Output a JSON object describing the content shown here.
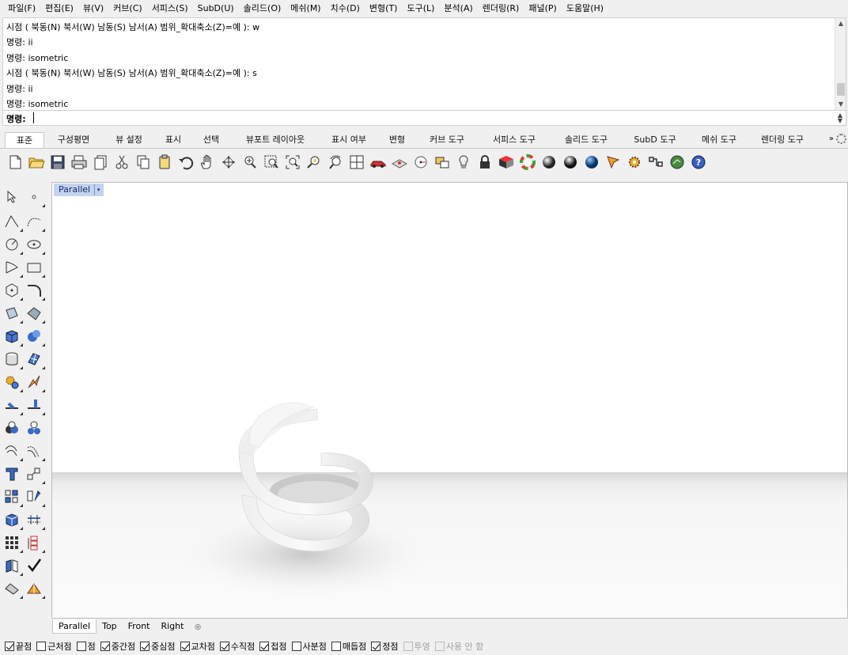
{
  "menu": [
    "파일(F)",
    "편집(E)",
    "뷰(V)",
    "커브(C)",
    "서피스(S)",
    "SubD(U)",
    "솔리드(O)",
    "메쉬(M)",
    "치수(D)",
    "변형(T)",
    "도구(L)",
    "분석(A)",
    "렌더링(R)",
    "패널(P)",
    "도움말(H)"
  ],
  "command_history": [
    "시점 ( 북동(N)  북서(W)  남동(S)  남서(A)  범위_확대축소(Z)=예 ): w",
    "명령: ii",
    "명령: isometric",
    "시점 ( 북동(N)  북서(W)  남동(S)  남서(A)  범위_확대축소(Z)=예 ): s",
    "명령: ii",
    "명령: isometric"
  ],
  "command_prompt": "명령:",
  "command_input_value": "",
  "toolbar_tabs": [
    "표준",
    "구성평면",
    "뷰 설정",
    "표시",
    "선택",
    "뷰포트 레이아웃",
    "표시 여부",
    "변형",
    "커브 도구",
    "서피스 도구",
    "솔리드 도구",
    "SubD 도구",
    "메쉬 도구",
    "렌더링 도구"
  ],
  "toolbar_tabs_more": "»",
  "main_toolbar_icons": [
    "new-icon",
    "open-icon",
    "save-icon",
    "print-icon",
    "import-icon",
    "cut-icon",
    "copy-icon",
    "paste-icon",
    "undo-icon",
    "pan-icon",
    "rotate-view-icon",
    "zoom-dynamic-icon",
    "zoom-window-icon",
    "zoom-extents-icon",
    "zoom-selected-icon",
    "undo-view-icon",
    "four-viewports-icon",
    "car-icon",
    "construction-plane-icon",
    "named-view-icon",
    "layers-icon",
    "light-icon",
    "lock-icon",
    "material-icon",
    "color-wheel-icon",
    "shaded-sphere-icon",
    "rendered-sphere-icon",
    "blue-sphere-icon",
    "render-icon",
    "options-gear-icon",
    "grasshopper-icon",
    "globe-icon",
    "help-icon"
  ],
  "left_toolbar_icons": [
    "select-arrow-icon",
    "point-icon",
    "polyline-icon",
    "curve-icon",
    "circle-icon",
    "ellipse-icon",
    "arc-icon",
    "rectangle-icon",
    "polygon-icon",
    "fillet-icon",
    "surface-icon",
    "extrude-icon",
    "box-icon",
    "sphere-icon",
    "cylinder-icon",
    "mesh-surface-icon",
    "gear-icon",
    "explode-icon",
    "split-icon",
    "trim-icon",
    "boolean-union-icon",
    "boolean-split-icon",
    "offset-icon",
    "blend-icon",
    "text-icon",
    "scale-icon",
    "array-icon",
    "mirror-icon",
    "cage-edit-icon",
    "align-icon",
    "grid-snap-icon",
    "dimension-icon",
    "transform-icon",
    "check-icon",
    "paint-icon",
    "analysis-icon"
  ],
  "viewport": {
    "label": "Parallel",
    "dropdown_glyph": "▾"
  },
  "view_tabs": [
    "Parallel",
    "Top",
    "Front",
    "Right"
  ],
  "view_tab_add": "⊕",
  "osnaps": [
    {
      "label": "끝점",
      "checked": true,
      "enabled": true
    },
    {
      "label": "근처점",
      "checked": false,
      "enabled": true
    },
    {
      "label": "점",
      "checked": false,
      "enabled": true
    },
    {
      "label": "중간점",
      "checked": true,
      "enabled": true
    },
    {
      "label": "중심점",
      "checked": true,
      "enabled": true
    },
    {
      "label": "교차점",
      "checked": true,
      "enabled": true
    },
    {
      "label": "수직점",
      "checked": true,
      "enabled": true
    },
    {
      "label": "접점",
      "checked": true,
      "enabled": true
    },
    {
      "label": "사분점",
      "checked": false,
      "enabled": true
    },
    {
      "label": "매듭점",
      "checked": false,
      "enabled": true
    },
    {
      "label": "정점",
      "checked": true,
      "enabled": true
    },
    {
      "label": "투영",
      "checked": false,
      "enabled": false
    },
    {
      "label": "사용 안 함",
      "checked": false,
      "enabled": false
    }
  ],
  "colors": {
    "viewport_label_bg": "#c3d3ef",
    "viewport_bg": "#ffffff",
    "ground": "#e8e8e8"
  }
}
